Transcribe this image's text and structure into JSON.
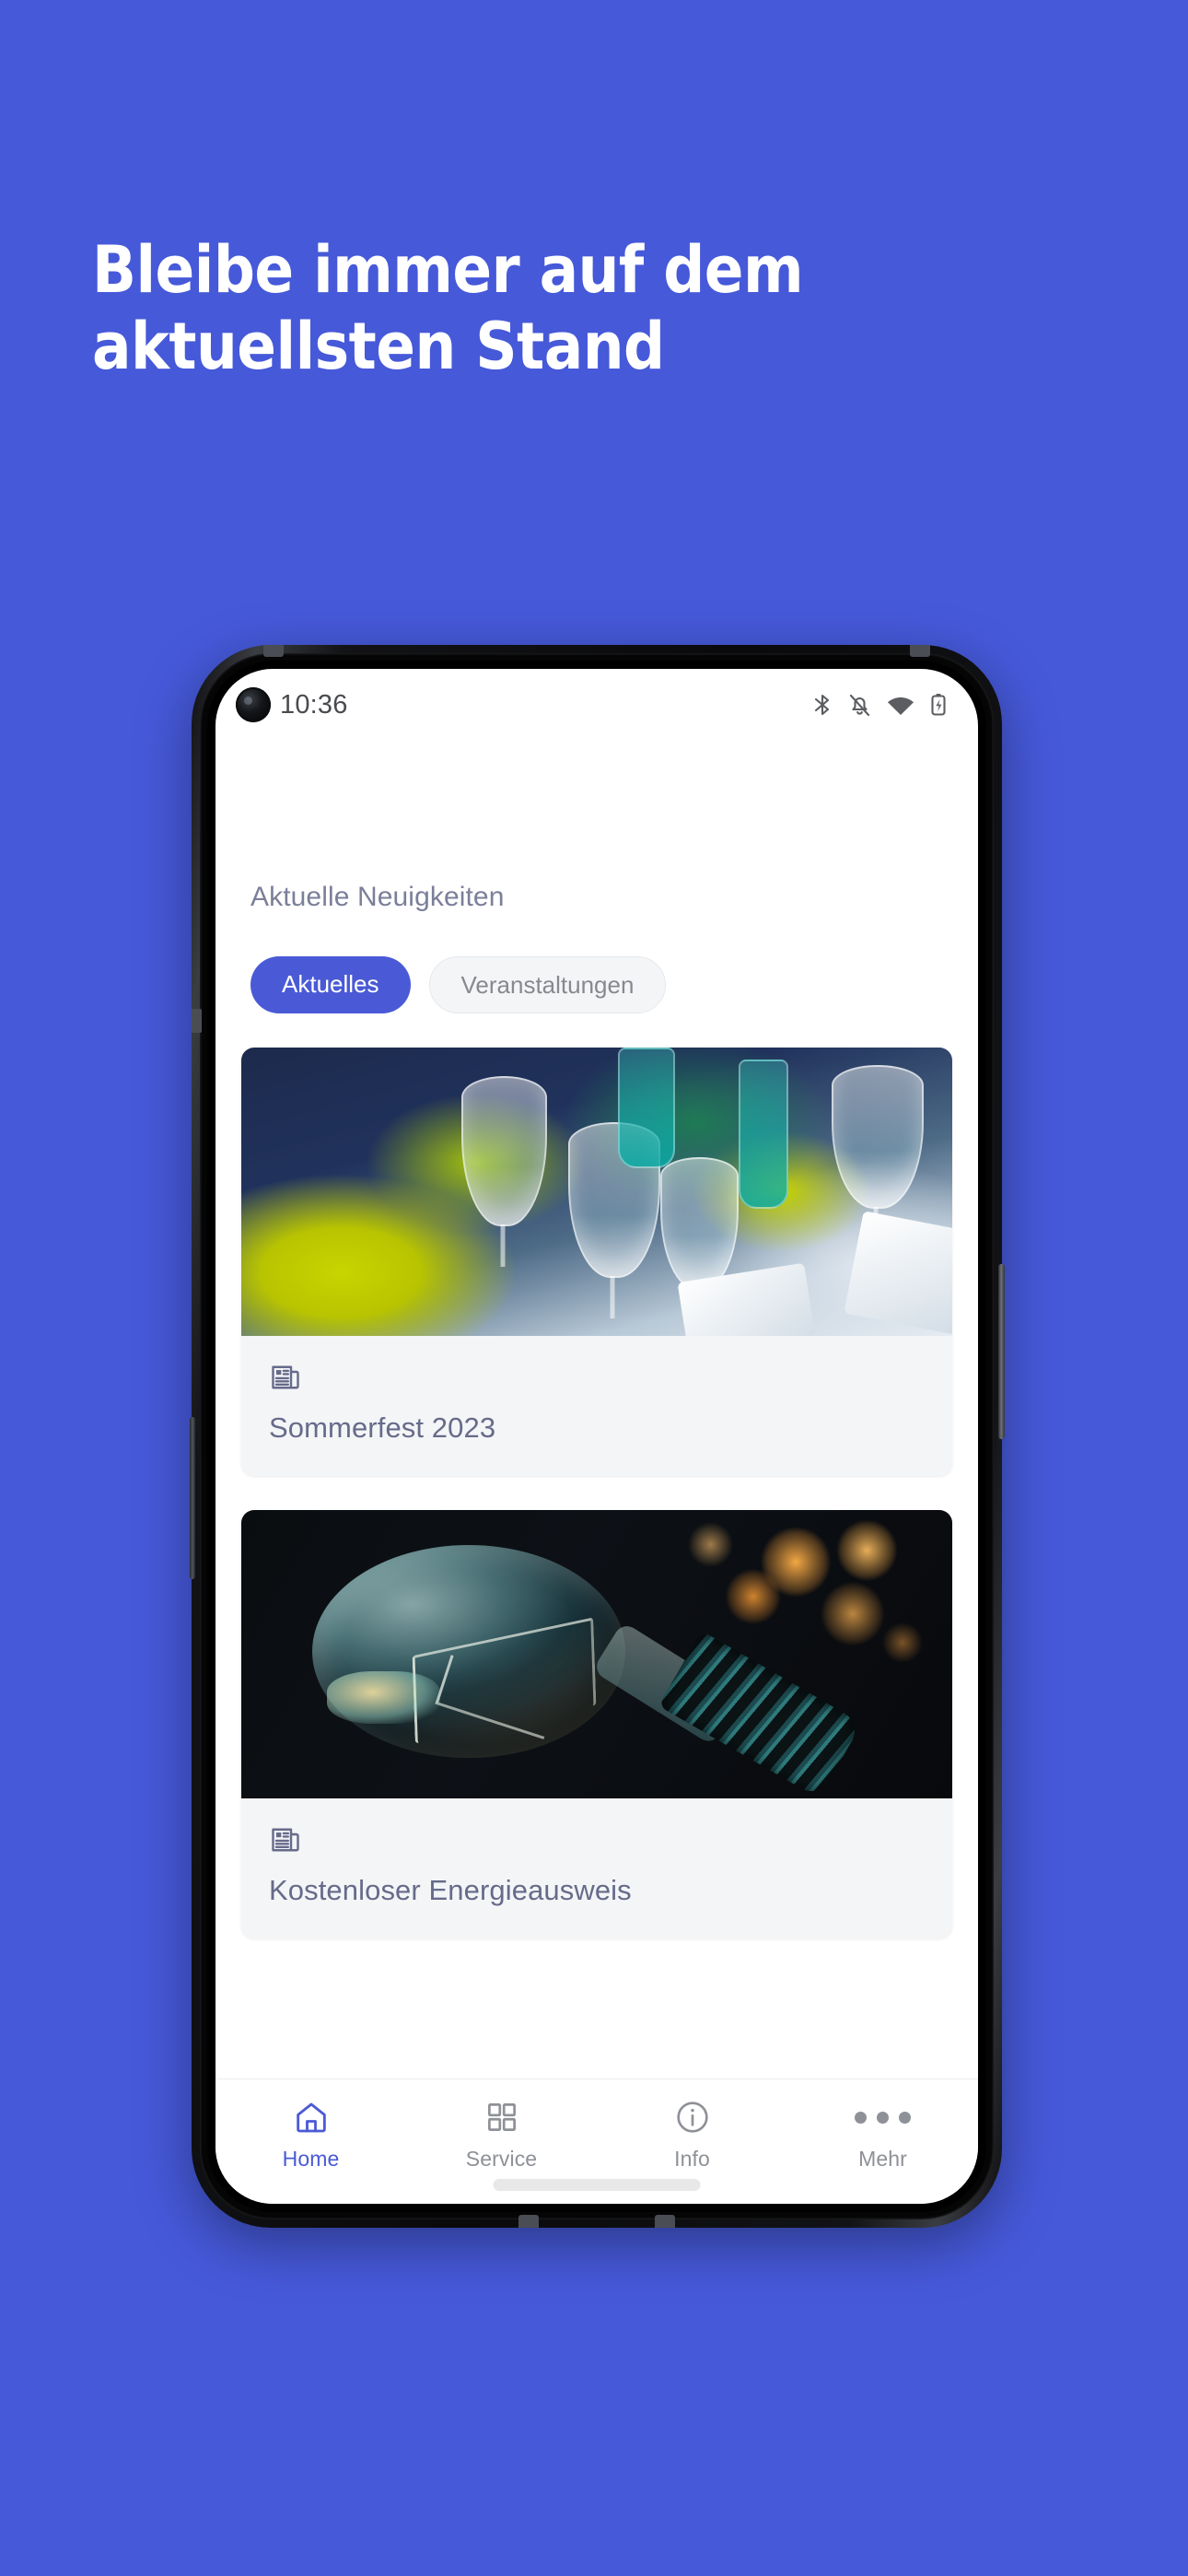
{
  "promo": {
    "headline": "Bleibe immer auf dem\naktuellsten Stand",
    "background_color": "#4659d9"
  },
  "phone": {
    "status_bar": {
      "time": "10:36",
      "icons": [
        "bluetooth-icon",
        "notifications-off-icon",
        "wifi-icon",
        "battery-charging-icon"
      ]
    },
    "screen": {
      "section_title": "Aktuelle Neuigkeiten",
      "tabs": [
        {
          "label": "Aktuelles",
          "active": true
        },
        {
          "label": "Veranstaltungen",
          "active": false
        }
      ],
      "cards": [
        {
          "title": "Sommerfest 2023",
          "icon": "newspaper-icon",
          "image": "festive-table-setting-with-glasses-and-flowers"
        },
        {
          "title": "Kostenloser Energieausweis",
          "icon": "newspaper-icon",
          "image": "light-bulb-with-orange-bokeh-lights"
        }
      ]
    },
    "bottom_nav": [
      {
        "label": "Home",
        "icon": "home-icon",
        "active": true
      },
      {
        "label": "Service",
        "icon": "grid-icon",
        "active": false
      },
      {
        "label": "Info",
        "icon": "info-icon",
        "active": false
      },
      {
        "label": "Mehr",
        "icon": "ellipsis-icon",
        "active": false
      }
    ]
  },
  "colors": {
    "brand_blue": "#4a5ad6",
    "background_blue": "#4659d9",
    "muted_text": "#7b7f99",
    "card_bg": "#f4f5f7",
    "nav_inactive": "#8e9197"
  }
}
